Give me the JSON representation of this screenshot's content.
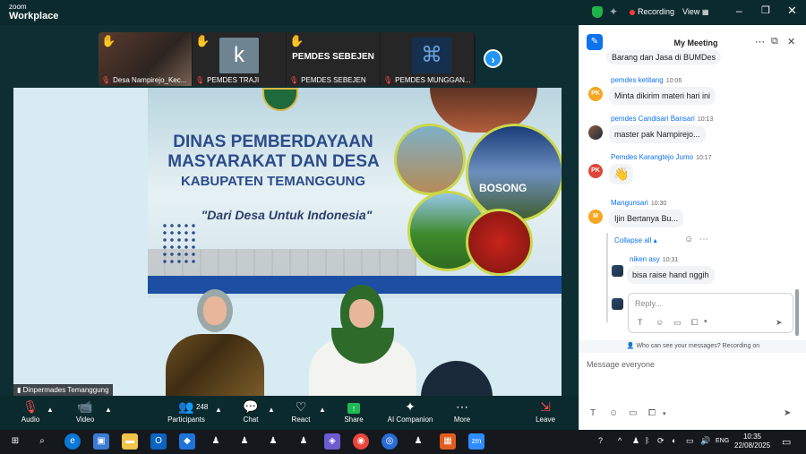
{
  "window": {
    "brand_small": "zoom",
    "brand_name": "Workplace",
    "recording_label": "Recording",
    "view_label": "View",
    "min_symbol": "–",
    "max_symbol": "❐",
    "close_symbol": "✕"
  },
  "thumbnails": [
    {
      "name": "Desa Nampirejo_Kec...",
      "hand": "✋"
    },
    {
      "name": "PEMDES TRAJI",
      "hand": "✋",
      "initial": "k"
    },
    {
      "name": "PEMDES SEBEJEN",
      "hand": "✋",
      "display": "PEMDES SEBEJEN"
    },
    {
      "name": "PEMDES MUNGGAN...",
      "hand": "✋"
    }
  ],
  "next_symbol": "›",
  "video": {
    "title1": "DINAS PEMBERDAYAAN",
    "title2": "MASYARAKAT DAN DESA",
    "title3": "KABUPATEN TEMANGGUNG",
    "slogan": "\"Dari Desa Untuk Indonesia\"",
    "bosong_text": "BOSONG",
    "speaker_label": "Dinpermades Temanggung"
  },
  "controls": {
    "audio": "Audio",
    "video": "Video",
    "participants": "Participants",
    "participant_count": "248",
    "chat": "Chat",
    "react": "React",
    "share": "Share",
    "ai_companion": "AI Companion",
    "more": "More",
    "leave": "Leave"
  },
  "chat": {
    "title": "My Meeting",
    "top_partial": "Barang dan Jasa di BUMDes",
    "messages": [
      {
        "sender": "pemdes ketitang",
        "time": "10:06",
        "avatar": "PK",
        "text": "Minta dikirim materi hari ini"
      },
      {
        "sender": "pemdes Candisari Bansari",
        "time": "10:13",
        "avatar": "",
        "text": "master pak Nampirejo..."
      },
      {
        "sender": "Pemdes Karangtejo Jumo",
        "time": "10:17",
        "avatar": "PK",
        "text": "👋"
      },
      {
        "sender": "Mangunsari",
        "time": "10:30",
        "avatar": "M",
        "text": "Ijin Bertanya Bu..."
      }
    ],
    "collapse_label": "Collapse all",
    "reply": {
      "sender": "niken asy",
      "time": "10:31",
      "text": "bisa raise hand nggih"
    },
    "reply_placeholder": "Reply...",
    "who_can_see": "Who can see your messages? Recording on",
    "message_placeholder": "Message everyone"
  },
  "taskbar": {
    "lang": "ENG",
    "time": "10:35",
    "date": "22/08/2025"
  }
}
